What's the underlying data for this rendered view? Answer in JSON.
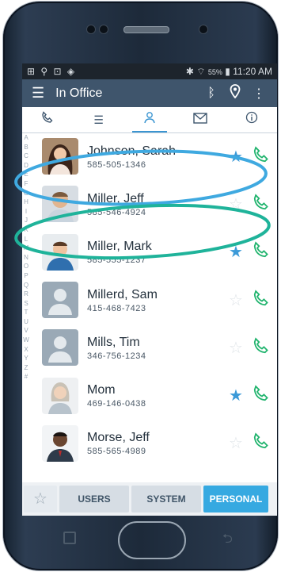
{
  "status_bar": {
    "battery": "55%",
    "time": "11:20 AM",
    "left_icons": "⊞ ⚲ ⊡ ◈"
  },
  "app_bar": {
    "title": "In Office"
  },
  "tabs": [
    {
      "name": "calls",
      "icon": "phone-icon"
    },
    {
      "name": "list",
      "icon": "list-icon"
    },
    {
      "name": "contacts",
      "icon": "person-icon",
      "active": true
    },
    {
      "name": "messages",
      "icon": "mail-icon"
    },
    {
      "name": "info",
      "icon": "info-icon"
    }
  ],
  "index_letters": [
    "A",
    "B",
    "C",
    "D",
    "E",
    "F",
    "G",
    "H",
    "I",
    "J",
    "K",
    "L",
    "M",
    "N",
    "O",
    "P",
    "Q",
    "R",
    "S",
    "T",
    "U",
    "V",
    "W",
    "X",
    "Y",
    "Z",
    "#"
  ],
  "contacts": [
    {
      "name": "Johnson, Sarah",
      "number": "585-505-1346",
      "favorite": true
    },
    {
      "name": "Miller, Jeff",
      "number": "585-546-4924",
      "favorite": false
    },
    {
      "name": "Miller, Mark",
      "number": "585-555-1237",
      "favorite": true
    },
    {
      "name": "Millerd, Sam",
      "number": "415-468-7423",
      "favorite": false
    },
    {
      "name": "Mills, Tim",
      "number": "346-756-1234",
      "favorite": false
    },
    {
      "name": "Mom",
      "number": "469-146-0438",
      "favorite": true
    },
    {
      "name": "Morse, Jeff",
      "number": "585-565-4989",
      "favorite": false
    }
  ],
  "bottom_bar": {
    "users": "USERS",
    "system": "SYSTEM",
    "personal": "PERSONAL"
  },
  "colors": {
    "accent": "#36a9e1",
    "appbar": "#3f556c",
    "call": "#21b46e",
    "highlight_blue": "#3fa9e0",
    "highlight_teal": "#1fb39a"
  }
}
